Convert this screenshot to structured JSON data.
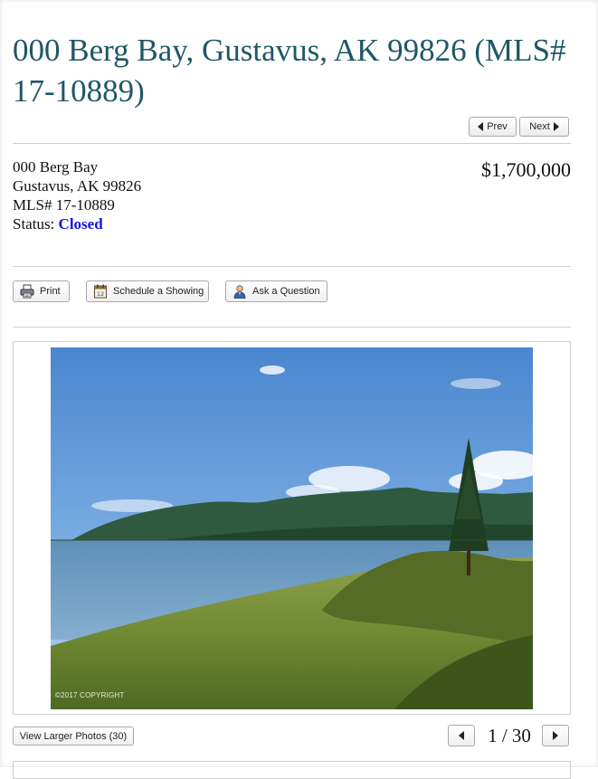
{
  "listing": {
    "title": "000 Berg Bay, Gustavus, AK 99826 (MLS# 17-10889)",
    "address_line1": "000 Berg Bay",
    "address_line2": "Gustavus, AK 99826",
    "mls_line": "MLS# 17-10889",
    "status_label": "Status:",
    "status_value": "Closed",
    "price": "$1,700,000"
  },
  "nav": {
    "prev_label": "Prev",
    "next_label": "Next"
  },
  "actions": {
    "print_label": "Print",
    "schedule_label": "Schedule a Showing",
    "ask_label": "Ask a Question"
  },
  "photo": {
    "copyright": "©2017 COPYRIGHT",
    "larger_photos_label": "View Larger Photos (30)",
    "counter": "1 / 30"
  },
  "icons": {
    "print": "printer-icon",
    "schedule": "calendar-icon",
    "ask": "person-icon",
    "prev": "triangle-left-icon",
    "next": "triangle-right-icon"
  },
  "colors": {
    "title": "#1e5866",
    "status_closed": "#1414e6"
  }
}
